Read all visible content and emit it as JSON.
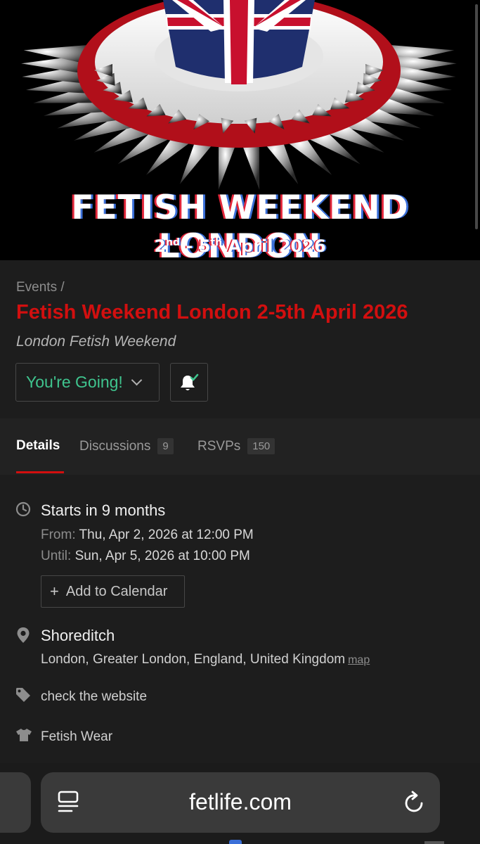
{
  "hero": {
    "title": "FETISH WEEKEND LONDON",
    "date_start_num": "2",
    "date_start_sup": "nd",
    "date_dash": " - ",
    "date_end_num": "5",
    "date_end_sup": "th",
    "date_rest": " April 2026"
  },
  "header": {
    "breadcrumb": "Events /",
    "title": "Fetish Weekend London 2-5th April 2026",
    "subtitle": "London Fetish Weekend",
    "rsvp_label": "You're Going!",
    "colors": {
      "title": "#d20f0f",
      "going": "#3fc48e"
    }
  },
  "tabs": [
    {
      "label": "Details",
      "count": ""
    },
    {
      "label": "Discussions",
      "count": "9"
    },
    {
      "label": "RSVPs",
      "count": "150"
    }
  ],
  "details": {
    "when_heading": "Starts in 9 months",
    "from_label": "From:",
    "from_value": "Thu, Apr 2, 2026 at 12:00 PM",
    "until_label": "Until:",
    "until_value": "Sun, Apr 5, 2026 at 10:00 PM",
    "add_calendar": "Add to Calendar",
    "venue": "Shoreditch",
    "address": "London, Greater London, England, United Kingdom",
    "map_link": "map",
    "cost": "check the website",
    "dress_code": "Fetish Wear"
  },
  "browser": {
    "url": "fetlife.com"
  },
  "icons": {
    "clock": "clock-icon",
    "pin": "map-pin-icon",
    "tag": "tag-icon",
    "shirt": "shirt-icon",
    "bell": "bell-check-icon",
    "reader": "reader-icon",
    "reload": "reload-icon"
  }
}
